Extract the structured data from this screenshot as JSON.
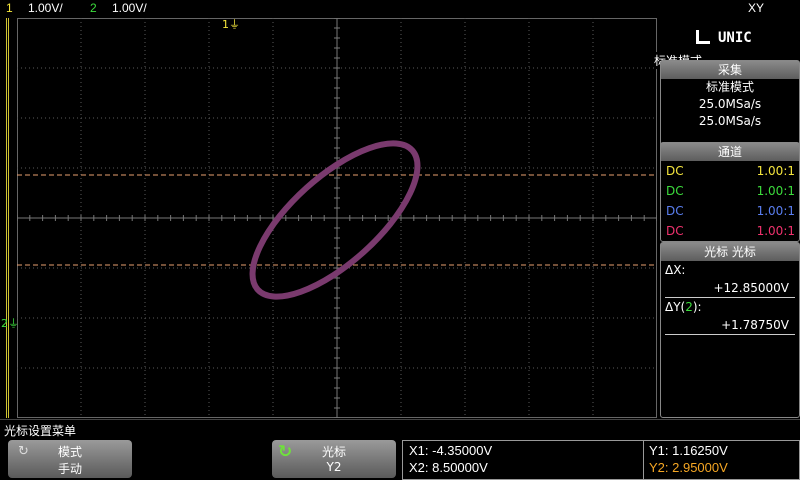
{
  "status": {
    "ch1_num": "1",
    "ch1_scale": "1.00V/",
    "ch2_num": "2",
    "ch2_scale": "1.00V/",
    "mode": "XY"
  },
  "screen": {
    "ch1_marker": "1",
    "ch2_marker": "2"
  },
  "brand": {
    "logo": "UNIC",
    "overlay_text": "标准模式"
  },
  "acquire": {
    "header": "采集",
    "mode": "标准模式",
    "rate1": "25.0MSa/s",
    "rate2": "25.0MSa/s"
  },
  "channels": {
    "header": "通道",
    "rows": [
      {
        "coupling": "DC",
        "ratio": "1.00:1",
        "color": "#f5e63c"
      },
      {
        "coupling": "DC",
        "ratio": "1.00:1",
        "color": "#3cdc3c"
      },
      {
        "coupling": "DC",
        "ratio": "1.00:1",
        "color": "#5a7ef0"
      },
      {
        "coupling": "DC",
        "ratio": "1.00:1",
        "color": "#f0326e"
      }
    ]
  },
  "cursors": {
    "header": "光标 光标",
    "dx_label": "ΔX:",
    "dx_value": "+12.85000V",
    "dy_label_pre": "ΔY(",
    "dy_label_ch": "2",
    "dy_label_post": "):",
    "dy_value": "+1.78750V"
  },
  "menu": {
    "title": "光标设置菜单",
    "mode_label": "模式",
    "mode_value": "手动",
    "cursor_label": "光标",
    "cursor_value": "Y2"
  },
  "readout": {
    "x1": "X1: -4.35000V",
    "x2": "X2: 8.50000V",
    "y1": "Y1: 1.16250V",
    "y2": "Y2: 2.95000V"
  },
  "colors": {
    "ch1": "#f5e63c",
    "ch2": "#3cdc3c",
    "trace": "#7a3a6e",
    "cursor_line": "#e8a070",
    "active_cursor": "#f5a623"
  }
}
